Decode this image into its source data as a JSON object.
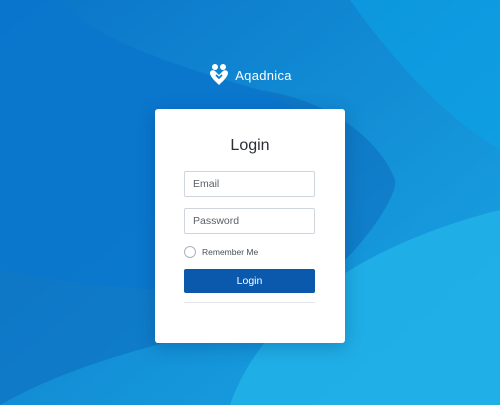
{
  "brand": {
    "name": "Aqadnica",
    "logo_icon": "heart-people-icon"
  },
  "colors": {
    "background_dark": "#0a6fc4",
    "background_light": "#26b3ea",
    "button": "#0b59ad",
    "card": "#ffffff"
  },
  "login_form": {
    "title": "Login",
    "email_placeholder": "Email",
    "email_value": "",
    "password_placeholder": "Password",
    "password_value": "",
    "remember_label": "Remember Me",
    "remember_checked": false,
    "submit_label": "Login"
  }
}
